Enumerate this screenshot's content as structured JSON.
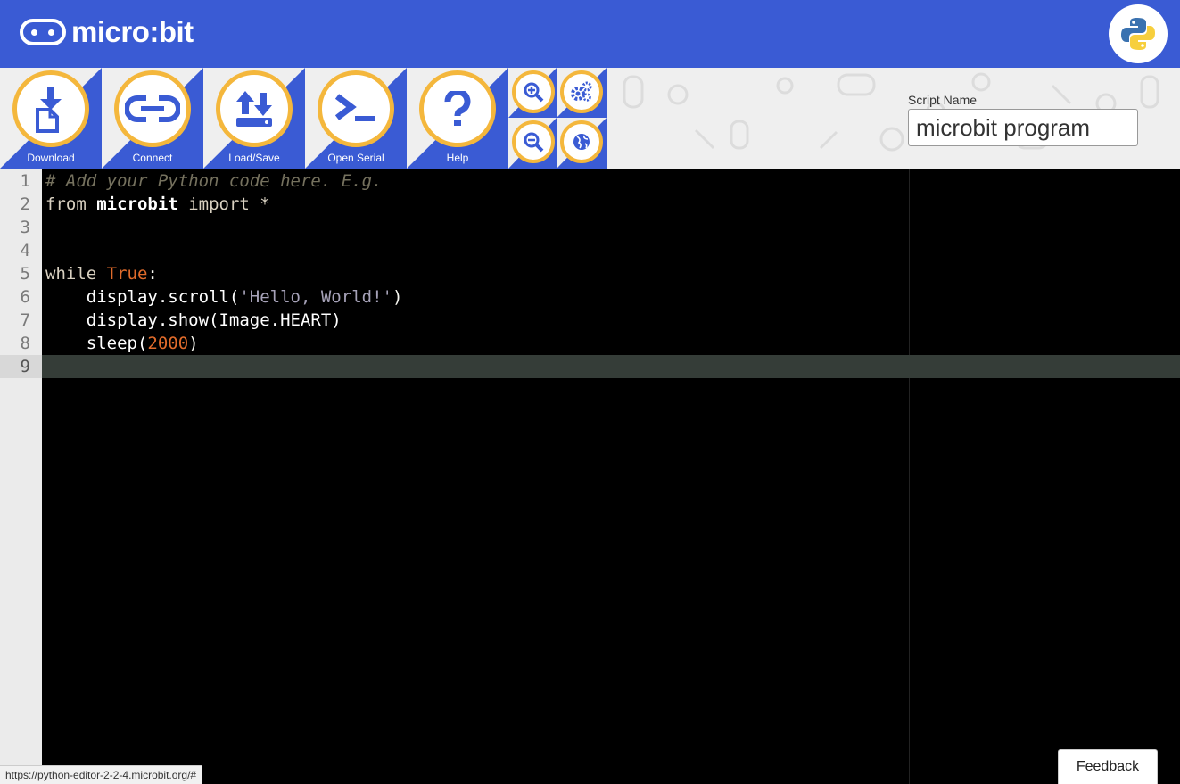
{
  "header": {
    "logo_text": "micro:bit",
    "brand_color": "#3a5bd4",
    "accent_color": "#f4b73c"
  },
  "toolbar": {
    "buttons": [
      {
        "label": "Download",
        "icon": "download-icon"
      },
      {
        "label": "Connect",
        "icon": "connect-icon"
      },
      {
        "label": "Load/Save",
        "icon": "load-save-icon"
      },
      {
        "label": "Open Serial",
        "icon": "terminal-icon"
      },
      {
        "label": "Help",
        "icon": "help-icon"
      }
    ],
    "small_buttons": [
      {
        "icon": "zoom-in-icon"
      },
      {
        "icon": "settings-icon"
      },
      {
        "icon": "zoom-out-icon"
      },
      {
        "icon": "language-icon"
      }
    ],
    "script_name_label": "Script Name",
    "script_name_value": "microbit program"
  },
  "editor": {
    "line_numbers": [
      "1",
      "2",
      "3",
      "4",
      "5",
      "6",
      "7",
      "8",
      "9"
    ],
    "lines": [
      "# Add your Python code here. E.g.",
      "from microbit import *",
      "",
      "",
      "while True:",
      "    display.scroll('Hello, World!')",
      "    display.show(Image.HEART)",
      "    sleep(2000)",
      ""
    ],
    "active_line": 9
  },
  "status": {
    "url": "https://python-editor-2-2-4.microbit.org/#"
  },
  "feedback_label": "Feedback"
}
